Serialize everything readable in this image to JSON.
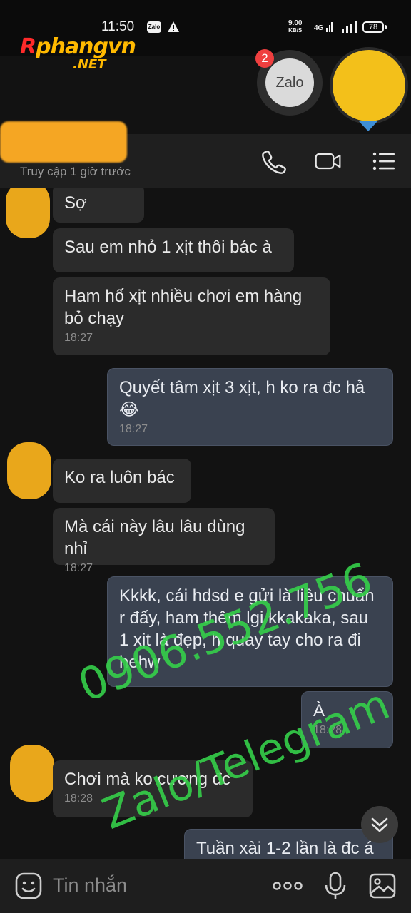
{
  "status_bar": {
    "time": "11:50",
    "zalo_label": "Zalo",
    "net_speed_value": "9.00",
    "net_speed_unit": "KB/S",
    "network": "4G",
    "battery": "78"
  },
  "brand": {
    "name_r": "R",
    "name_rest": "phangvn",
    "suffix": ".NET"
  },
  "floating": {
    "app_label": "Zalo",
    "badge_count": "2"
  },
  "header": {
    "status": "Truy cập 1 giờ trước"
  },
  "messages": [
    {
      "side": "in",
      "text": "Sợ",
      "time": ""
    },
    {
      "side": "in",
      "text": "Sau em nhỏ 1 xịt thôi bác à",
      "time": ""
    },
    {
      "side": "in",
      "text": "Ham hố xịt nhiều chơi em hàng bỏ chạy",
      "time": "18:27"
    },
    {
      "side": "out",
      "text": "Quyết tâm xịt 3 xịt, h ko ra đc hả 😂",
      "time": "18:27"
    },
    {
      "side": "in",
      "text": "Ko ra luôn bác",
      "time": ""
    },
    {
      "side": "in",
      "text": "Mà cái này lâu lâu dùng nhỉ",
      "time": "18:27"
    },
    {
      "side": "out",
      "text": "Kkkk, cái hdsd e gửi là liều chuẩn r đấy, ham thêm lgi kkakaka, sau 1 xịt là đẹp, h quay tay cho ra đi hehw",
      "time": ""
    },
    {
      "side": "out",
      "text": "À",
      "time": "18:28"
    },
    {
      "side": "in",
      "text": "Chơi mà ko cương đc",
      "time": "18:28"
    },
    {
      "side": "out",
      "text": "Tuần xài 1-2 lần là đc á",
      "time": ""
    }
  ],
  "watermark": {
    "phone": "0906.552.756",
    "channels": "Zalo/Telegram"
  },
  "input": {
    "placeholder": "Tin nhắn"
  },
  "icons": {
    "call": "phone-icon",
    "video": "video-icon",
    "menu": "menu-icon",
    "emoji": "emoji-icon",
    "more": "more-icon",
    "mic": "mic-icon",
    "image": "image-icon",
    "scroll": "chevrons-down-icon"
  },
  "colors": {
    "watermark": "#35d04a",
    "incoming_bubble": "#2b2b2b",
    "outgoing_bubble": "#3a4250",
    "badge": "#ef3f3f"
  }
}
